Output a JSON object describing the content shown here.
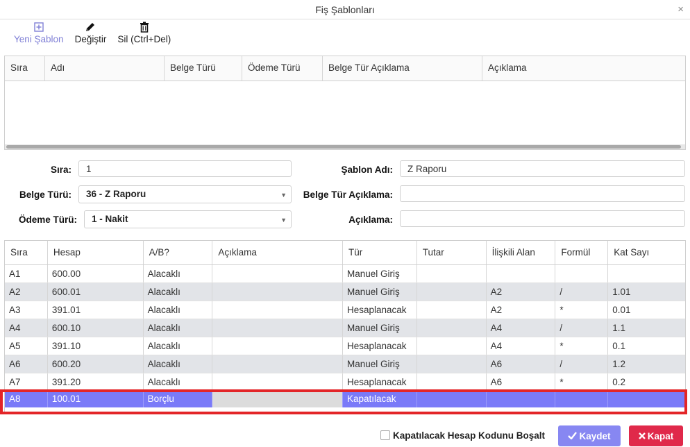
{
  "window": {
    "title": "Fiş Şablonları",
    "close_glyph": "×"
  },
  "toolbar": {
    "new_label": "Yeni Şablon",
    "edit_label": "Değiştir",
    "delete_label": "Sil (Ctrl+Del)",
    "new_icon": "plus-square-icon",
    "edit_icon": "pencil-icon",
    "delete_icon": "trash-icon"
  },
  "top_grid": {
    "headers": [
      "Sıra",
      "Adı",
      "Belge Türü",
      "Ödeme Türü",
      "Belge Tür Açıklama",
      "Açıklama"
    ]
  },
  "form": {
    "sira_label": "Sıra:",
    "sira_value": "1",
    "sablon_adi_label": "Şablon Adı:",
    "sablon_adi_value": "Z Raporu",
    "belge_turu_label": "Belge Türü:",
    "belge_turu_value": "36 - Z Raporu",
    "belge_tur_aciklama_label": "Belge Tür Açıklama:",
    "belge_tur_aciklama_value": "",
    "odeme_turu_label": "Ödeme Türü:",
    "odeme_turu_value": "1 - Nakit",
    "aciklama_label": "Açıklama:",
    "aciklama_value": ""
  },
  "main_grid": {
    "headers": [
      "Sıra",
      "Hesap",
      "A/B?",
      "Açıklama",
      "Tür",
      "Tutar",
      "İlişkili Alan",
      "Formül",
      "Kat Sayı"
    ],
    "rows": [
      [
        "A1",
        "600.00",
        "Alacaklı",
        "",
        "Manuel Giriş",
        "",
        "",
        "",
        ""
      ],
      [
        "A2",
        "600.01",
        "Alacaklı",
        "",
        "Manuel Giriş",
        "",
        "A2",
        "/",
        "1.01"
      ],
      [
        "A3",
        "391.01",
        "Alacaklı",
        "",
        "Hesaplanacak",
        "",
        "A2",
        "*",
        "0.01"
      ],
      [
        "A4",
        "600.10",
        "Alacaklı",
        "",
        "Manuel Giriş",
        "",
        "A4",
        "/",
        "1.1"
      ],
      [
        "A5",
        "391.10",
        "Alacaklı",
        "",
        "Hesaplanacak",
        "",
        "A4",
        "*",
        "0.1"
      ],
      [
        "A6",
        "600.20",
        "Alacaklı",
        "",
        "Manuel Giriş",
        "",
        "A6",
        "/",
        "1.2"
      ],
      [
        "A7",
        "391.20",
        "Alacaklı",
        "",
        "Hesaplanacak",
        "",
        "A6",
        "*",
        "0.2"
      ],
      [
        "A8",
        "100.01",
        "Borçlu",
        "",
        "Kapatılacak",
        "",
        "",
        "",
        ""
      ]
    ],
    "selected_row_index": 7
  },
  "footer": {
    "checkbox_label": "Kapatılacak Hesap Kodunu Boşalt",
    "checkbox_checked": false,
    "save_label": "Kaydet",
    "close_label": "Kapat"
  },
  "colors": {
    "selection": "#7a7af8",
    "highlight_frame": "#e32528",
    "save_button": "#8787f2",
    "close_button": "#e0294a",
    "disabled_text": "#7f7fd6"
  }
}
